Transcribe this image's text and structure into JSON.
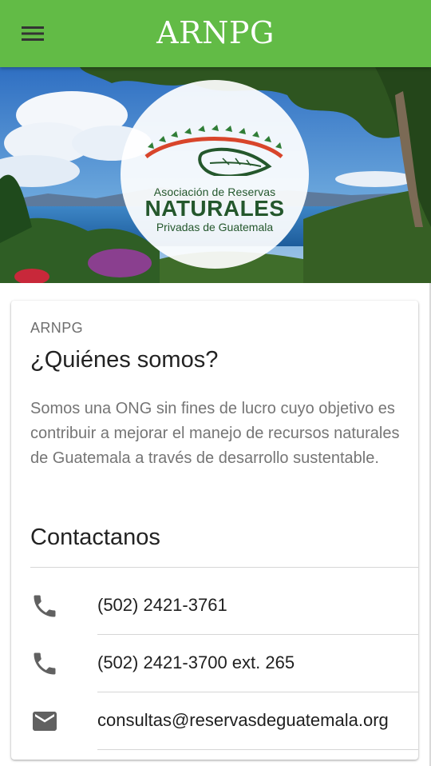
{
  "app_bar": {
    "title": "ARNPG",
    "menu_icon": "hamburger-menu-icon",
    "color": "#62bb46"
  },
  "hero": {
    "logo": {
      "line1": "Asociación de Reservas",
      "line2": "NATURALES",
      "line3": "Privadas de Guatemala"
    }
  },
  "card": {
    "overline": "ARNPG",
    "title": "¿Quiénes somos?",
    "body": "Somos una ONG sin fines de lucro cuyo objetivo es contribuir a mejorar el manejo de recursos naturales de Guatemala a través de desarrollo sustentable.",
    "contact_heading": "Contactanos",
    "contacts": [
      {
        "icon": "phone-icon",
        "text": "(502) 2421-3761"
      },
      {
        "icon": "phone-icon",
        "text": "(502) 2421-3700 ext. 265"
      },
      {
        "icon": "email-icon",
        "text": "consultas@reservasdeguatemala.org"
      }
    ]
  }
}
